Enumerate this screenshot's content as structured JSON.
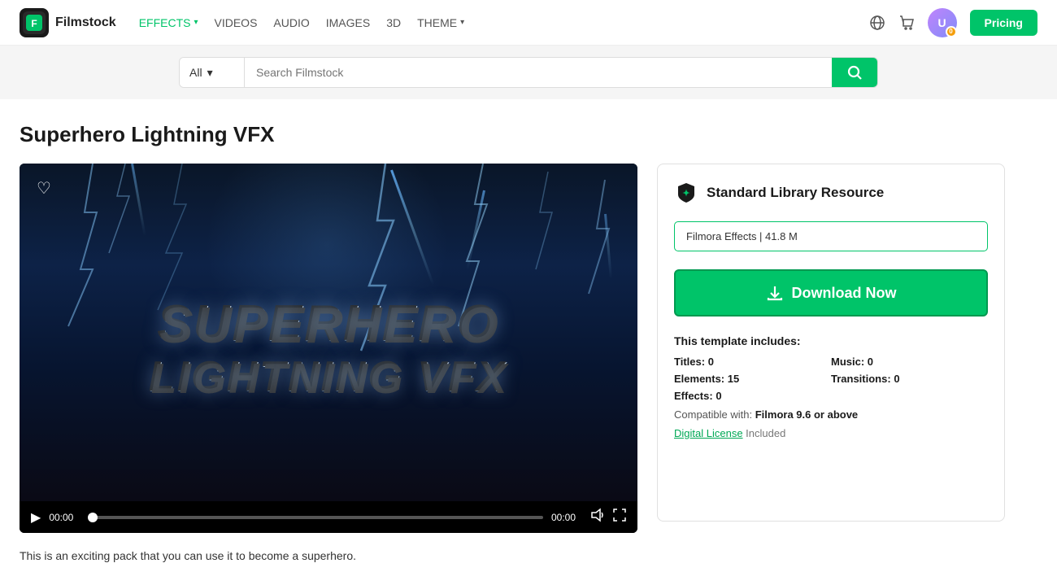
{
  "brand": {
    "name": "Filmstock"
  },
  "nav": {
    "items": [
      {
        "label": "EFFECTS",
        "active": true,
        "has_dropdown": true
      },
      {
        "label": "VIDEOS",
        "active": false,
        "has_dropdown": false
      },
      {
        "label": "AUDIO",
        "active": false,
        "has_dropdown": false
      },
      {
        "label": "IMAGES",
        "active": false,
        "has_dropdown": false
      },
      {
        "label": "3D",
        "active": false,
        "has_dropdown": false
      },
      {
        "label": "THEME",
        "active": false,
        "has_dropdown": true
      }
    ],
    "pricing_label": "Pricing"
  },
  "search": {
    "dropdown_label": "All",
    "placeholder": "Search Filmstock"
  },
  "page": {
    "title": "Superhero Lightning VFX",
    "description": "This is an exciting pack that you can use it to become a superhero."
  },
  "video": {
    "title_line1": "SUPERHERO",
    "title_line2": "LIGHTNING VFX",
    "time_current": "00:00",
    "time_total": "00:00"
  },
  "panel": {
    "badge_label": "Standard Library Resource",
    "file_info": "Filmora Effects | 41.8 M",
    "download_label": "Download Now",
    "includes_title": "This template includes:",
    "titles_label": "Titles:",
    "titles_value": "0",
    "music_label": "Music:",
    "music_value": "0",
    "elements_label": "Elements:",
    "elements_value": "15",
    "transitions_label": "Transitions:",
    "transitions_value": "0",
    "effects_label": "Effects:",
    "effects_value": "0",
    "compatible_label": "Compatible with:",
    "compatible_value": "Filmora 9.6 or above",
    "license_link_text": "Digital License",
    "license_included_text": "Included"
  }
}
